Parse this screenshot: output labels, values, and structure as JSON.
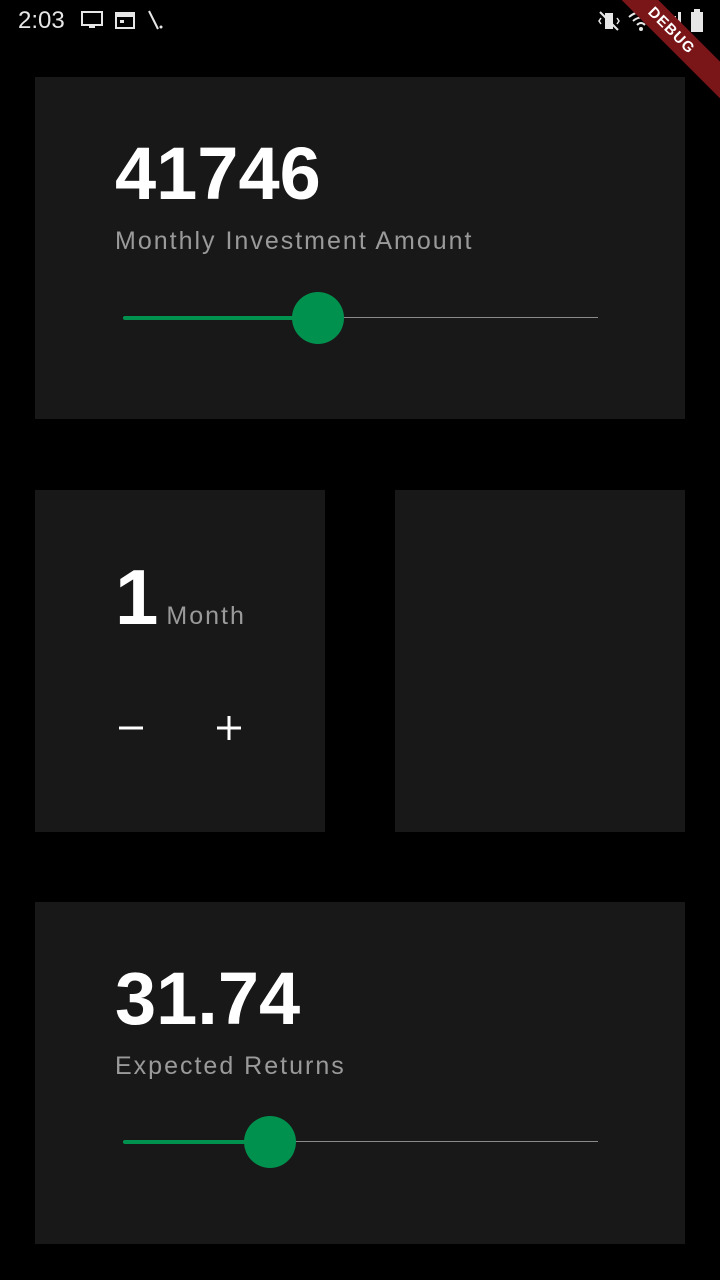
{
  "status_bar": {
    "time": "2:03",
    "left_icons": [
      "monitor-icon",
      "calendar-icon",
      "signal-slash-icon"
    ],
    "right_icons": [
      "vibrate-mute-icon",
      "wifi-icon",
      "cell-signal-icon",
      "battery-icon"
    ]
  },
  "debug_banner": {
    "label": "DEBUG",
    "color": "#7a1518"
  },
  "investment": {
    "value": "41746",
    "label": "Monthly Investment Amount",
    "slider_fraction": 0.41
  },
  "duration": {
    "value": "1",
    "unit": "Month",
    "decrement_label": "−",
    "increment_label": "+"
  },
  "returns": {
    "value": "31.74",
    "label": "Expected Returns",
    "slider_fraction": 0.31
  },
  "colors": {
    "background": "#000000",
    "card": "#181818",
    "accent": "#00914e",
    "label": "#9a9a9a"
  }
}
